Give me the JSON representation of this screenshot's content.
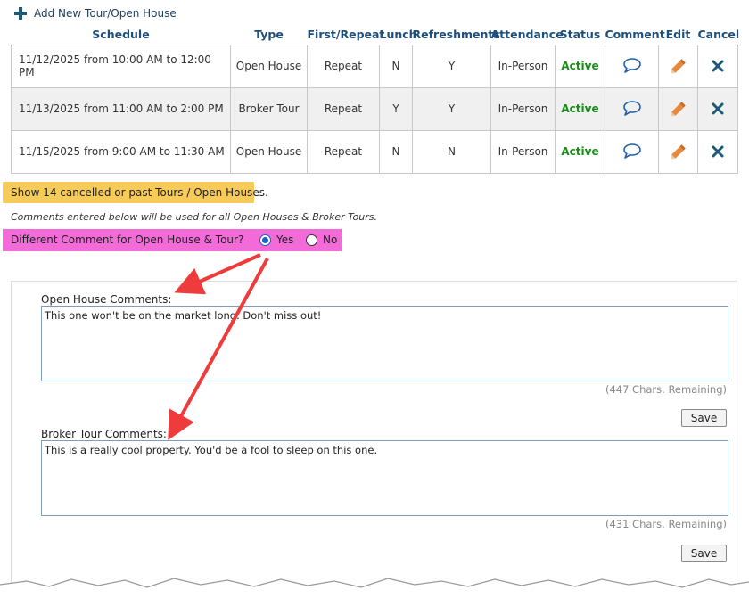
{
  "add_tour": {
    "label": "Add New Tour/Open House"
  },
  "table": {
    "headers": [
      "Schedule",
      "Type",
      "First/Repeat",
      "Lunch",
      "Refreshments",
      "Attendance",
      "Status",
      "Comment",
      "Edit",
      "Cancel"
    ],
    "rows": [
      {
        "schedule": "11/12/2025 from 10:00 AM to 12:00 PM",
        "type": "Open House",
        "first_repeat": "Repeat",
        "lunch": "N",
        "refreshments": "Y",
        "attendance": "In-Person",
        "status": "Active"
      },
      {
        "schedule": "11/13/2025 from 11:00 AM to 2:00 PM",
        "type": "Broker Tour",
        "first_repeat": "Repeat",
        "lunch": "Y",
        "refreshments": "Y",
        "attendance": "In-Person",
        "status": "Active"
      },
      {
        "schedule": "11/15/2025 from 9:00 AM to 11:30 AM",
        "type": "Open House",
        "first_repeat": "Repeat",
        "lunch": "N",
        "refreshments": "N",
        "attendance": "In-Person",
        "status": "Active"
      }
    ],
    "icons": {
      "comment": "speech-bubble-icon",
      "edit": "pencil-icon",
      "cancel": "x-icon"
    }
  },
  "show_cancelled": "Show 14 cancelled or past Tours / Open Houses.",
  "comments_note": "Comments entered below will be used for all Open Houses & Broker Tours.",
  "different_comment": {
    "question": "Different Comment for Open House & Tour?",
    "yes_label": "Yes",
    "no_label": "No",
    "selected": "Yes"
  },
  "open_house_comments": {
    "label": "Open House Comments:",
    "value": "This one won't be on the market long. Don't miss out!",
    "chars_remaining": "(447 Chars. Remaining)",
    "save_label": "Save"
  },
  "broker_tour_comments": {
    "label": "Broker Tour Comments:",
    "value": "This is a really cool property. You'd be a fool to sleep on this one.",
    "chars_remaining": "(431 Chars. Remaining)",
    "save_label": "Save"
  },
  "colors": {
    "header_text": "#1e4e79",
    "active_status": "#1a8a1a",
    "comment_icon": "#1f5ea8",
    "edit_icon": "#e8883a",
    "cancel_icon": "#1e5a73",
    "cancelled_highlight": "#f7cb5a",
    "different_comment_highlight": "#f26bd9",
    "annotation_arrow": "#ee3b3b"
  }
}
